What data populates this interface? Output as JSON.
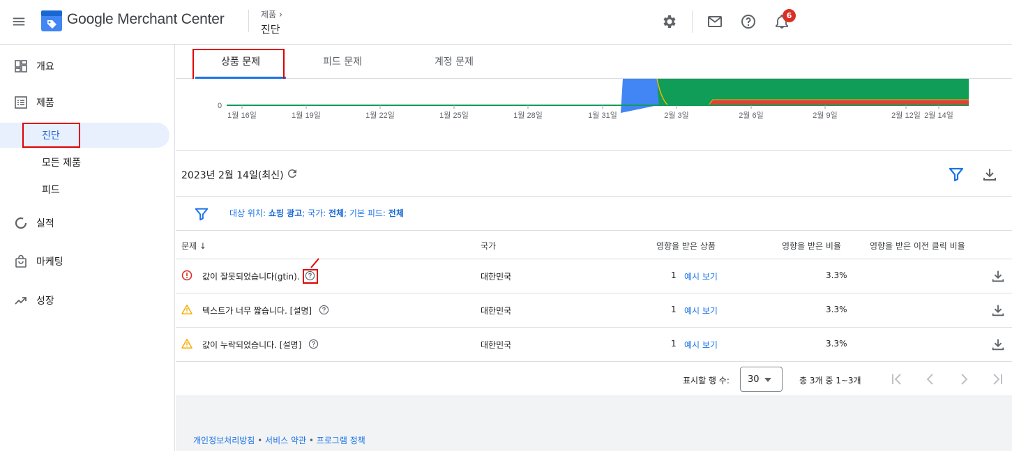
{
  "header": {
    "brand": "Google Merchant Center",
    "breadcrumb_parent": "제품",
    "breadcrumb_current": "진단",
    "notification_count": "6",
    "colors": {
      "badge": "#d93025",
      "accent": "#1a73e8"
    }
  },
  "sidebar": {
    "items": [
      {
        "label": "개요",
        "icon": "dashboard-icon"
      },
      {
        "label": "제품",
        "icon": "list-icon"
      },
      {
        "label": "실적",
        "icon": "donut-icon"
      },
      {
        "label": "마케팅",
        "icon": "shopping-bag-icon"
      },
      {
        "label": "성장",
        "icon": "trending-up-icon"
      }
    ],
    "sub_items": [
      {
        "label": "진단",
        "active": true
      },
      {
        "label": "모든 제품"
      },
      {
        "label": "피드"
      }
    ]
  },
  "tabs": [
    {
      "label": "상품 문제",
      "active": true
    },
    {
      "label": "피드 문제"
    },
    {
      "label": "계정 문제"
    }
  ],
  "chart_data": {
    "type": "area",
    "x": [
      "1월 16일",
      "1월 19일",
      "1월 22일",
      "1월 25일",
      "1월 28일",
      "1월 31일",
      "2월 3일",
      "2월 6일",
      "2월 9일",
      "2월 12일",
      "2월 14일"
    ],
    "y_tick_visible": "0",
    "colors": {
      "blue": "#4285f4",
      "green": "#0f9d58",
      "red": "#db4437",
      "orange": "#f4b400"
    }
  },
  "report": {
    "date": "2023년 2월 14일(최신)",
    "filter": {
      "location_label": "대상 위치: ",
      "location_value": "쇼핑 광고",
      "country_label": "; 국가: ",
      "country_value": "전체",
      "feed_label": "; 기본 피드: ",
      "feed_value": "전체"
    },
    "columns": [
      "문제",
      "국가",
      "영향을 받은 상품",
      "영향을 받은 비율",
      "영향을 받은 이전 클릭 비율"
    ],
    "rows": [
      {
        "severity": "error",
        "issue": "값이 잘못되었습니다(gtin).",
        "country": "대한민국",
        "count": "1",
        "link": "예시 보기",
        "pct": "3.3%"
      },
      {
        "severity": "warning",
        "issue": "텍스트가 너무 짧습니다. [설명]",
        "country": "대한민국",
        "count": "1",
        "link": "예시 보기",
        "pct": "3.3%"
      },
      {
        "severity": "warning",
        "issue": "값이 누락되었습니다. [설명]",
        "country": "대한민국",
        "count": "1",
        "link": "예시 보기",
        "pct": "3.3%"
      }
    ],
    "pager": {
      "rows_label": "표시할 행 수:",
      "rows_value": "30",
      "range": "총 3개 중 1~3개"
    }
  },
  "footer": {
    "links": [
      "개인정보처리방침",
      "서비스 약관",
      "프로그램 정책"
    ],
    "separator": " • "
  }
}
